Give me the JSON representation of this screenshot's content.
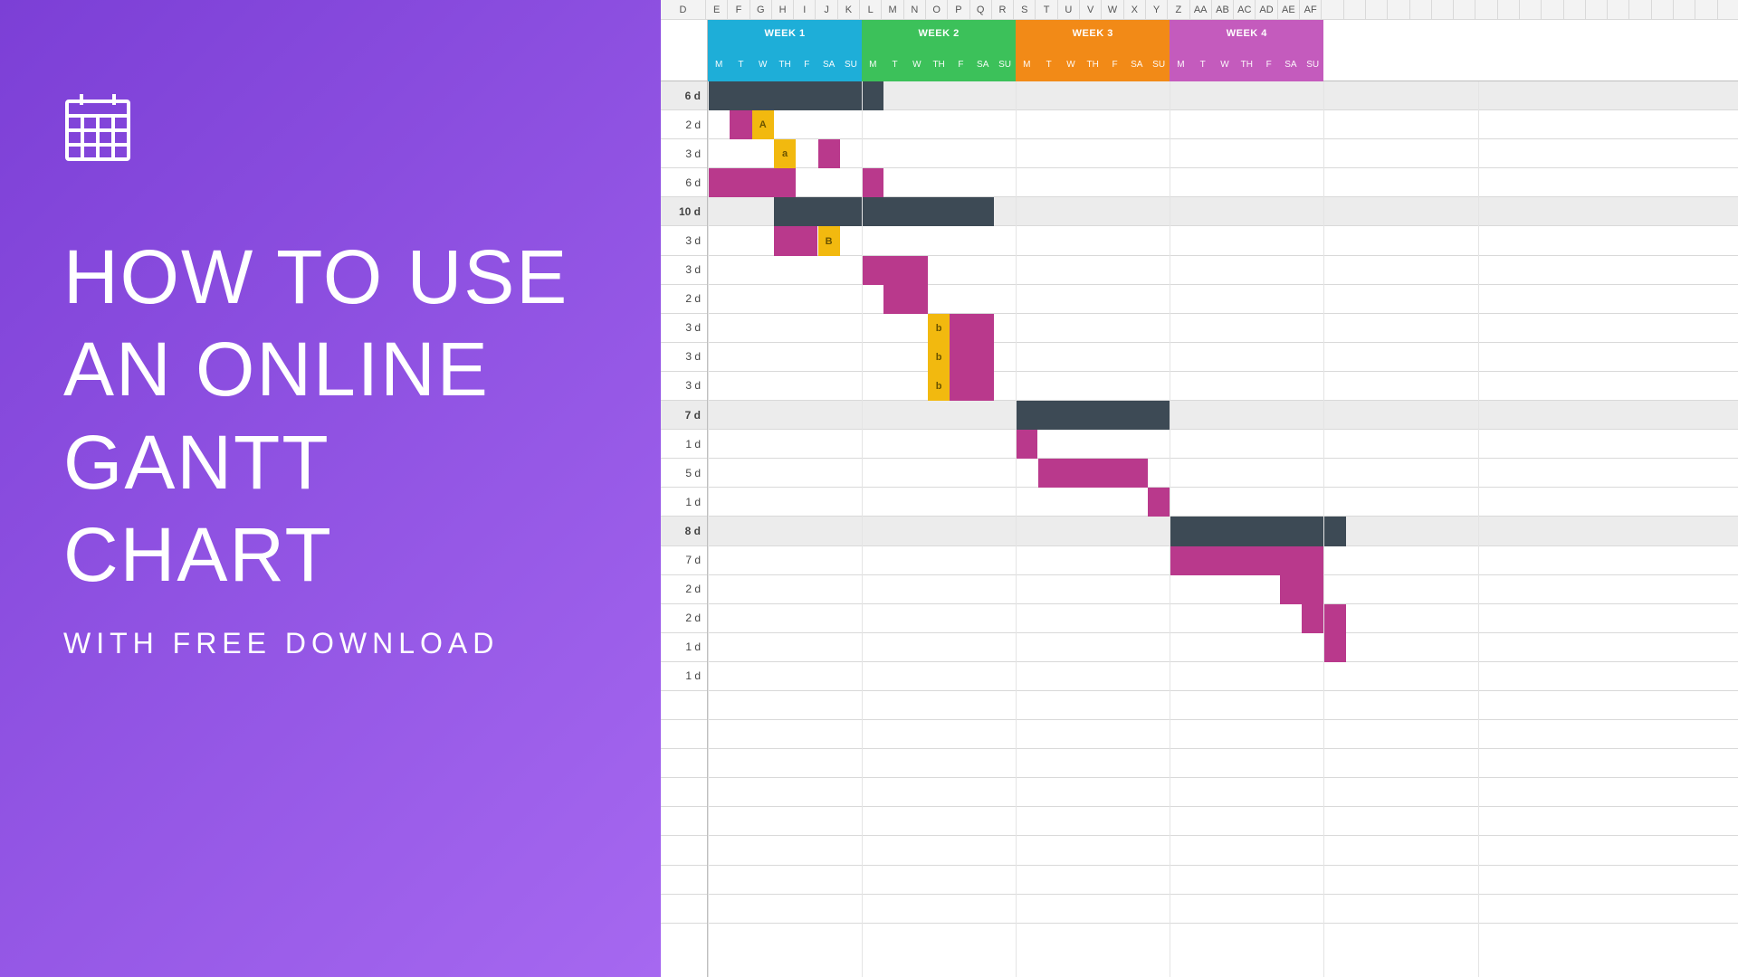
{
  "left": {
    "title_line1": "HOW TO USE",
    "title_line2": "AN ONLINE",
    "title_line3": "GANTT CHART",
    "subtitle": "WITH FREE DOWNLOAD"
  },
  "columns": [
    "D",
    "E",
    "F",
    "G",
    "H",
    "I",
    "J",
    "K",
    "L",
    "M",
    "N",
    "O",
    "P",
    "Q",
    "R",
    "S",
    "T",
    "U",
    "V",
    "W",
    "X",
    "Y",
    "Z",
    "AA",
    "AB",
    "AC",
    "AD",
    "AE",
    "AF"
  ],
  "weeks": [
    {
      "label": "WEEK 1",
      "color": "#1eaed8",
      "days": [
        "M",
        "T",
        "W",
        "TH",
        "F",
        "SA",
        "SU"
      ]
    },
    {
      "label": "WEEK 2",
      "color": "#3cc15a",
      "days": [
        "M",
        "T",
        "W",
        "TH",
        "F",
        "SA",
        "SU"
      ]
    },
    {
      "label": "WEEK 3",
      "color": "#f28a17",
      "days": [
        "M",
        "T",
        "W",
        "TH",
        "F",
        "SA",
        "SU"
      ]
    },
    {
      "label": "WEEK 4",
      "color": "#c45bbd",
      "days": [
        "M",
        "T",
        "W",
        "TH",
        "F",
        "SA",
        "SU"
      ]
    }
  ],
  "chart_data": {
    "type": "gantt",
    "title": "",
    "x_unit": "day",
    "x_range": [
      0,
      28
    ],
    "week_length": 7,
    "colors": {
      "summary": "#3d4a55",
      "task": "#b9398c",
      "marker": "#f2b90f"
    },
    "rows": [
      {
        "duration": "6 d",
        "summary": true,
        "bars": [
          {
            "start": 0,
            "len": 8,
            "type": "sum"
          }
        ]
      },
      {
        "duration": "2 d",
        "summary": false,
        "bars": [
          {
            "start": 1,
            "len": 2,
            "type": "task"
          }
        ],
        "markers": [
          {
            "day": 2,
            "label": "A"
          }
        ]
      },
      {
        "duration": "3 d",
        "summary": false,
        "bars": [
          {
            "start": 3,
            "len": 1,
            "type": "task"
          },
          {
            "start": 5,
            "len": 1,
            "type": "task"
          }
        ],
        "markers": [
          {
            "day": 3,
            "label": "a"
          }
        ]
      },
      {
        "duration": "6 d",
        "summary": false,
        "bars": [
          {
            "start": 0,
            "len": 4,
            "type": "task"
          },
          {
            "start": 7,
            "len": 1,
            "type": "task"
          }
        ]
      },
      {
        "duration": "10 d",
        "summary": true,
        "bars": [
          {
            "start": 3,
            "len": 10,
            "type": "sum"
          }
        ]
      },
      {
        "duration": "3 d",
        "summary": false,
        "bars": [
          {
            "start": 3,
            "len": 2,
            "type": "task"
          }
        ],
        "markers": [
          {
            "day": 5,
            "label": "B"
          }
        ]
      },
      {
        "duration": "3 d",
        "summary": false,
        "bars": [
          {
            "start": 7,
            "len": 3,
            "type": "task"
          }
        ]
      },
      {
        "duration": "2 d",
        "summary": false,
        "bars": [
          {
            "start": 8,
            "len": 2,
            "type": "task"
          }
        ]
      },
      {
        "duration": "3 d",
        "summary": false,
        "bars": [
          {
            "start": 11,
            "len": 2,
            "type": "task"
          }
        ],
        "markers": [
          {
            "day": 10,
            "label": "b"
          }
        ]
      },
      {
        "duration": "3 d",
        "summary": false,
        "bars": [
          {
            "start": 11,
            "len": 2,
            "type": "task"
          }
        ],
        "markers": [
          {
            "day": 10,
            "label": "b"
          }
        ]
      },
      {
        "duration": "3 d",
        "summary": false,
        "bars": [
          {
            "start": 11,
            "len": 2,
            "type": "task"
          }
        ],
        "markers": [
          {
            "day": 10,
            "label": "b"
          }
        ]
      },
      {
        "duration": "7 d",
        "summary": true,
        "bars": [
          {
            "start": 14,
            "len": 7,
            "type": "sum"
          }
        ]
      },
      {
        "duration": "1 d",
        "summary": false,
        "bars": [
          {
            "start": 14,
            "len": 1,
            "type": "task"
          }
        ]
      },
      {
        "duration": "5 d",
        "summary": false,
        "bars": [
          {
            "start": 15,
            "len": 5,
            "type": "task"
          }
        ]
      },
      {
        "duration": "1 d",
        "summary": false,
        "bars": [
          {
            "start": 20,
            "len": 1,
            "type": "task"
          }
        ]
      },
      {
        "duration": "8 d",
        "summary": true,
        "bars": [
          {
            "start": 21,
            "len": 8,
            "type": "sum"
          }
        ]
      },
      {
        "duration": "7 d",
        "summary": false,
        "bars": [
          {
            "start": 21,
            "len": 7,
            "type": "task"
          }
        ]
      },
      {
        "duration": "2 d",
        "summary": false,
        "bars": [
          {
            "start": 26,
            "len": 2,
            "type": "task"
          }
        ]
      },
      {
        "duration": "2 d",
        "summary": false,
        "bars": [
          {
            "start": 27,
            "len": 2,
            "type": "task"
          }
        ]
      },
      {
        "duration": "1 d",
        "summary": false,
        "bars": [
          {
            "start": 28,
            "len": 1,
            "type": "task"
          }
        ]
      },
      {
        "duration": "1 d",
        "summary": false,
        "bars": []
      }
    ]
  }
}
